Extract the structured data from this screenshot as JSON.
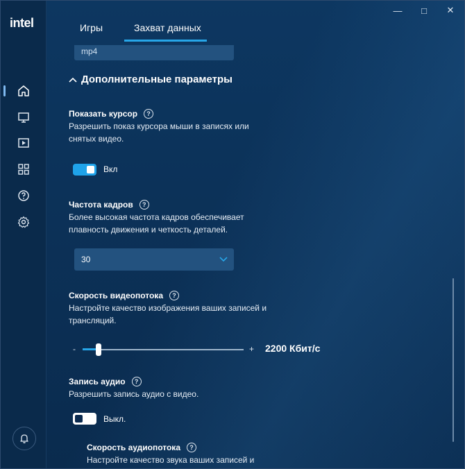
{
  "brand": {
    "logo_text": "intel"
  },
  "window_controls": {
    "minimize": "—",
    "maximize": "□",
    "close": "✕"
  },
  "tabs": [
    {
      "label": "Игры",
      "active": false
    },
    {
      "label": "Захват данных",
      "active": true
    }
  ],
  "colors": {
    "accent": "#27a6e8",
    "toggle_on": "#1fa3ea",
    "background": "#0c3259",
    "field": "#23527f"
  },
  "sidebar": {
    "icons": [
      "home-icon",
      "monitor-icon",
      "video-icon",
      "apps-grid-icon",
      "help-icon",
      "gear-icon"
    ],
    "active": "home-icon",
    "bottom_icon": "bell-icon"
  },
  "partial_field": {
    "text": "mp4"
  },
  "section": {
    "title": "Дополнительные параметры",
    "icon": "chevron-up-icon"
  },
  "show_cursor": {
    "label": "Показать курсор",
    "description": "Разрешить показ курсора мыши в записях или снятых видео.",
    "toggle_state": "on",
    "toggle_label": "Вкл"
  },
  "frame_rate": {
    "label": "Частота кадров",
    "description": "Более высокая частота кадров обеспечивает плавность движения и четкость деталей.",
    "selected": "30"
  },
  "bitrate": {
    "label": "Скорость видеопотока",
    "description": "Настройте качество изображения ваших записей и трансляций.",
    "minus": "-",
    "plus": "+",
    "value_text": "2200 Кбит/с",
    "slider_fraction": 0.1
  },
  "audio": {
    "label": "Запись аудио",
    "description": "Разрешить запись аудио с видео.",
    "toggle_state": "off",
    "toggle_label": "Выкл."
  },
  "audio_bitrate": {
    "label": "Скорость аудиопотока",
    "description": "Настройте качество звука ваших записей и"
  }
}
